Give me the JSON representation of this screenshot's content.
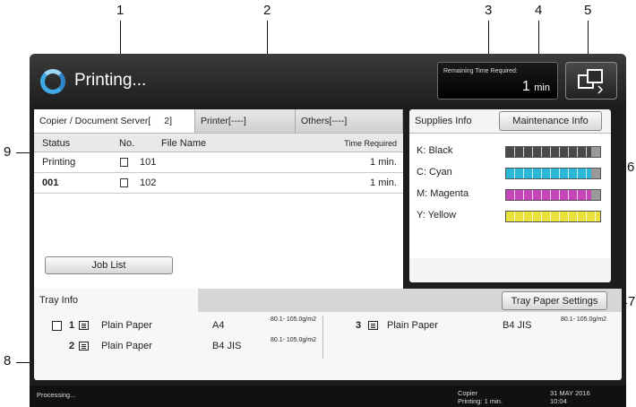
{
  "callouts": [
    "1",
    "2",
    "3",
    "4",
    "5",
    "6",
    "7",
    "8",
    "9"
  ],
  "header": {
    "title": "Printing...",
    "remaining_label": "Remaining Time Required:",
    "remaining_value": "1",
    "remaining_unit": "min"
  },
  "jobs": {
    "tabs": [
      {
        "label": "Copier / Document Server[",
        "count": "2]"
      },
      {
        "label": "Printer[----]",
        "count": ""
      },
      {
        "label": "Others[----]",
        "count": ""
      }
    ],
    "columns": {
      "status": "Status",
      "no": "No.",
      "file_name": "File Name",
      "time": "Time Required"
    },
    "rows": [
      {
        "status": "Printing",
        "no": "101",
        "file_name": "",
        "time": "1 min."
      },
      {
        "status": "001",
        "no": "102",
        "file_name": "",
        "time": "1 min."
      }
    ],
    "job_list_button": "Job List"
  },
  "supplies": {
    "title": "Supplies Info",
    "maintenance_button": "Maintenance Info",
    "items": [
      {
        "label": "K: Black",
        "color": "#4a4a4a",
        "level": 0.9
      },
      {
        "label": "C: Cyan",
        "color": "#2bb7d6",
        "level": 0.9
      },
      {
        "label": "M: Magenta",
        "color": "#c646b8",
        "level": 0.9
      },
      {
        "label": "Y: Yellow",
        "color": "#e8e23a",
        "level": 1.0
      }
    ]
  },
  "tray": {
    "title": "Tray Info",
    "settings_button": "Tray Paper Settings",
    "rows": [
      {
        "num": "1",
        "type": "Plain Paper",
        "size": "A4",
        "weight": "80.1- 105.0g/m2"
      },
      {
        "num": "2",
        "type": "Plain Paper",
        "size": "B4 JIS",
        "weight": "80.1- 105.0g/m2"
      },
      {
        "num": "3",
        "type": "Plain Paper",
        "size": "B4 JIS",
        "weight": "80.1- 105.0g/m2"
      }
    ]
  },
  "status_bar": {
    "left": "Processing...",
    "mode": "Copier",
    "printing": "Printing: 1 min.",
    "date": "31 MAY 2016",
    "time": "10:04"
  }
}
